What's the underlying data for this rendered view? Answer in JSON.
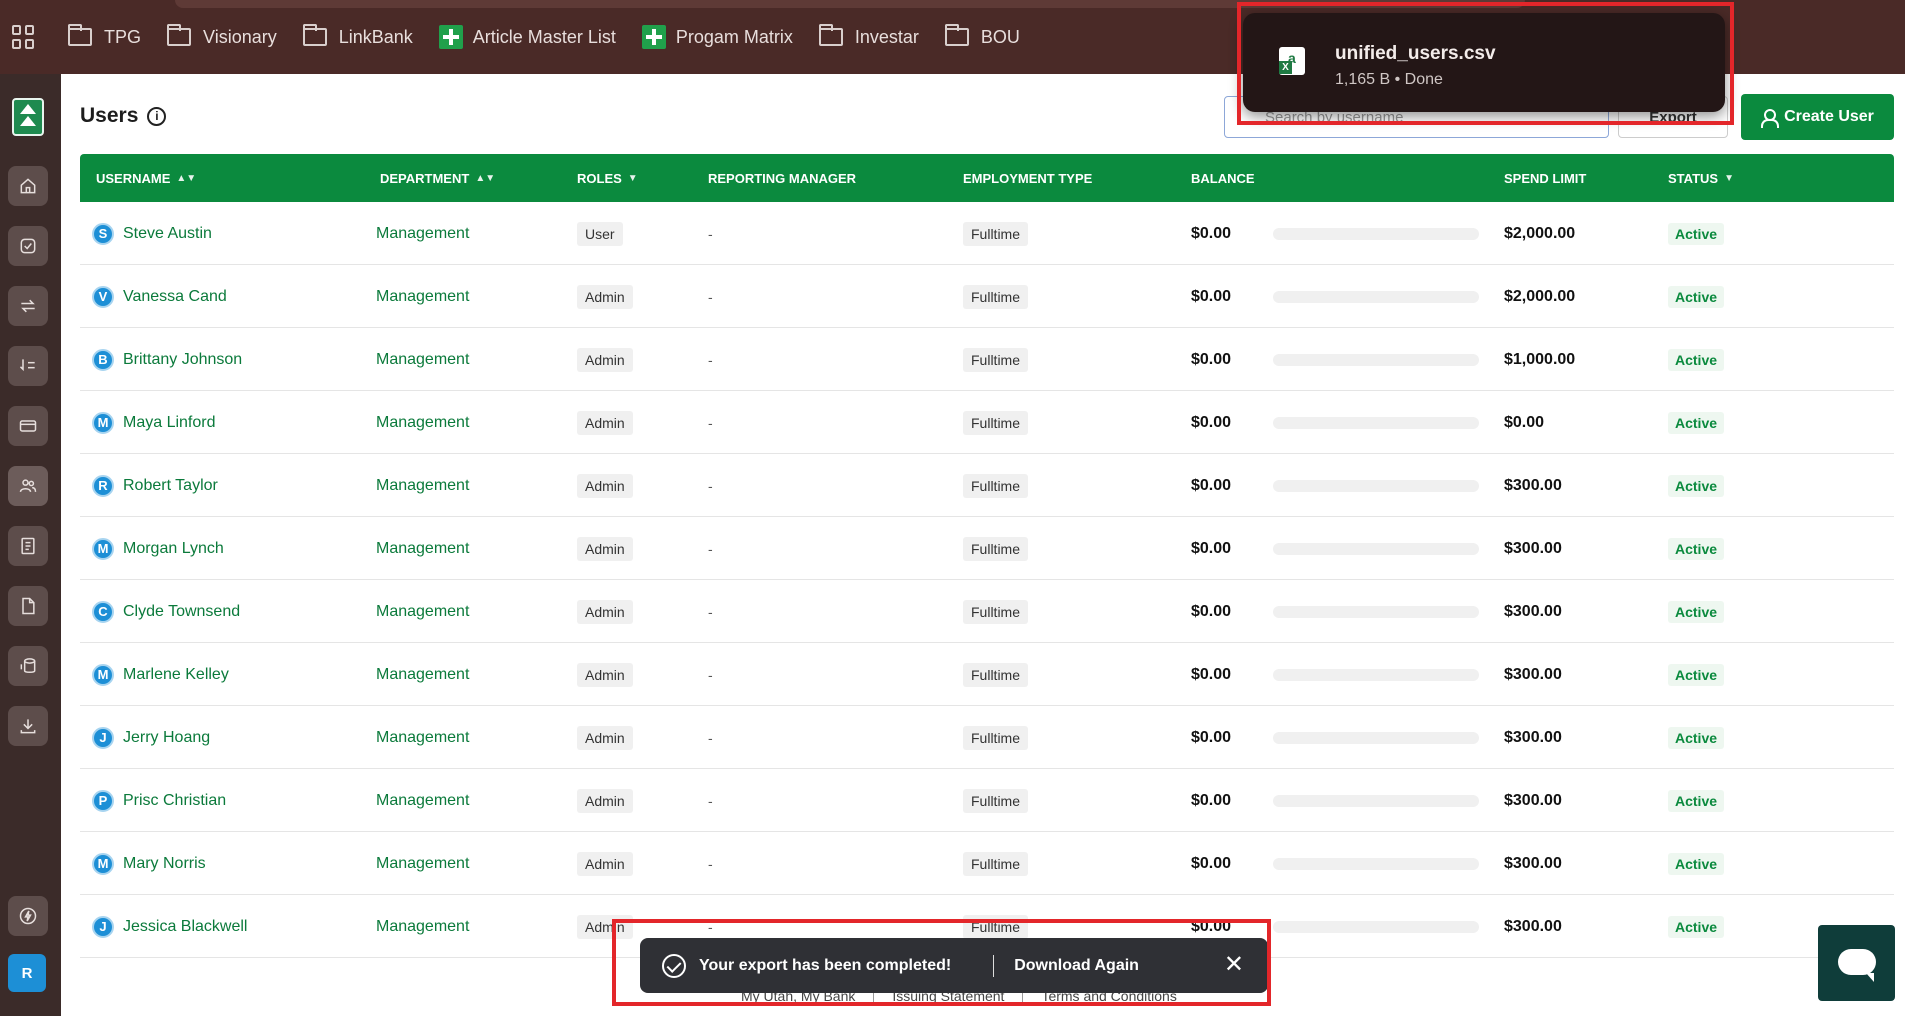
{
  "bookmarks": [
    {
      "label": "TPG",
      "type": "folder"
    },
    {
      "label": "Visionary",
      "type": "folder"
    },
    {
      "label": "LinkBank",
      "type": "folder"
    },
    {
      "label": "Article Master List",
      "type": "sheet"
    },
    {
      "label": "Progam Matrix",
      "type": "sheet"
    },
    {
      "label": "Investar",
      "type": "folder"
    },
    {
      "label": "BOU",
      "type": "folder"
    }
  ],
  "sidebar": {
    "avatar_initial": "R",
    "items": [
      "home-icon",
      "check-circle-icon",
      "transfer-icon",
      "exchange-icon",
      "card-icon",
      "users-icon",
      "receipt-icon",
      "document-icon",
      "bank-icon",
      "download-icon",
      "lightning-icon"
    ]
  },
  "header": {
    "title": "Users",
    "search_placeholder": "Search by username",
    "export_label": "Export",
    "create_label": "Create User"
  },
  "table": {
    "columns": {
      "username": "USERNAME",
      "department": "DEPARTMENT",
      "roles": "ROLES",
      "manager": "REPORTING MANAGER",
      "employment": "EMPLOYMENT TYPE",
      "balance": "BALANCE",
      "spend_limit": "SPEND LIMIT",
      "status": "STATUS"
    },
    "rows": [
      {
        "initial": "S",
        "username": "Steve Austin",
        "department": "Management",
        "role": "User",
        "manager": "-",
        "employment": "Fulltime",
        "balance": "$0.00",
        "balance_fraction": 0,
        "spend_limit": "$2,000.00",
        "status": "Active"
      },
      {
        "initial": "V",
        "username": "Vanessa Cand",
        "department": "Management",
        "role": "Admin",
        "manager": "-",
        "employment": "Fulltime",
        "balance": "$0.00",
        "balance_fraction": 0,
        "spend_limit": "$2,000.00",
        "status": "Active"
      },
      {
        "initial": "B",
        "username": "Brittany Johnson",
        "department": "Management",
        "role": "Admin",
        "manager": "-",
        "employment": "Fulltime",
        "balance": "$0.00",
        "balance_fraction": 0,
        "spend_limit": "$1,000.00",
        "status": "Active"
      },
      {
        "initial": "M",
        "username": "Maya Linford",
        "department": "Management",
        "role": "Admin",
        "manager": "-",
        "employment": "Fulltime",
        "balance": "$0.00",
        "balance_fraction": 0,
        "spend_limit": "$0.00",
        "status": "Active"
      },
      {
        "initial": "R",
        "username": "Robert Taylor",
        "department": "Management",
        "role": "Admin",
        "manager": "-",
        "employment": "Fulltime",
        "balance": "$0.00",
        "balance_fraction": 0,
        "spend_limit": "$300.00",
        "status": "Active"
      },
      {
        "initial": "M",
        "username": "Morgan Lynch",
        "department": "Management",
        "role": "Admin",
        "manager": "-",
        "employment": "Fulltime",
        "balance": "$0.00",
        "balance_fraction": 0,
        "spend_limit": "$300.00",
        "status": "Active"
      },
      {
        "initial": "C",
        "username": "Clyde Townsend",
        "department": "Management",
        "role": "Admin",
        "manager": "-",
        "employment": "Fulltime",
        "balance": "$0.00",
        "balance_fraction": 0,
        "spend_limit": "$300.00",
        "status": "Active"
      },
      {
        "initial": "M",
        "username": "Marlene Kelley",
        "department": "Management",
        "role": "Admin",
        "manager": "-",
        "employment": "Fulltime",
        "balance": "$0.00",
        "balance_fraction": 0,
        "spend_limit": "$300.00",
        "status": "Active"
      },
      {
        "initial": "J",
        "username": "Jerry Hoang",
        "department": "Management",
        "role": "Admin",
        "manager": "-",
        "employment": "Fulltime",
        "balance": "$0.00",
        "balance_fraction": 0,
        "spend_limit": "$300.00",
        "status": "Active"
      },
      {
        "initial": "P",
        "username": "Prisc Christian",
        "department": "Management",
        "role": "Admin",
        "manager": "-",
        "employment": "Fulltime",
        "balance": "$0.00",
        "balance_fraction": 0,
        "spend_limit": "$300.00",
        "status": "Active"
      },
      {
        "initial": "M",
        "username": "Mary Norris",
        "department": "Management",
        "role": "Admin",
        "manager": "-",
        "employment": "Fulltime",
        "balance": "$0.00",
        "balance_fraction": 0,
        "spend_limit": "$300.00",
        "status": "Active"
      },
      {
        "initial": "J",
        "username": "Jessica Blackwell",
        "department": "Management",
        "role": "Admin",
        "manager": "-",
        "employment": "Fulltime",
        "balance": "$0.00",
        "balance_fraction": 0,
        "spend_limit": "$300.00",
        "status": "Active"
      }
    ]
  },
  "footer": [
    "My Utah, My Bank",
    "Issuing Statement",
    "Terms and Conditions"
  ],
  "download": {
    "filename": "unified_users.csv",
    "meta": "1,165 B • Done"
  },
  "toast": {
    "message": "Your export has been completed!",
    "action": "Download Again",
    "close": "✕"
  },
  "colors": {
    "brand_green": "#0b8a3e",
    "highlight_red": "#e3262a"
  }
}
